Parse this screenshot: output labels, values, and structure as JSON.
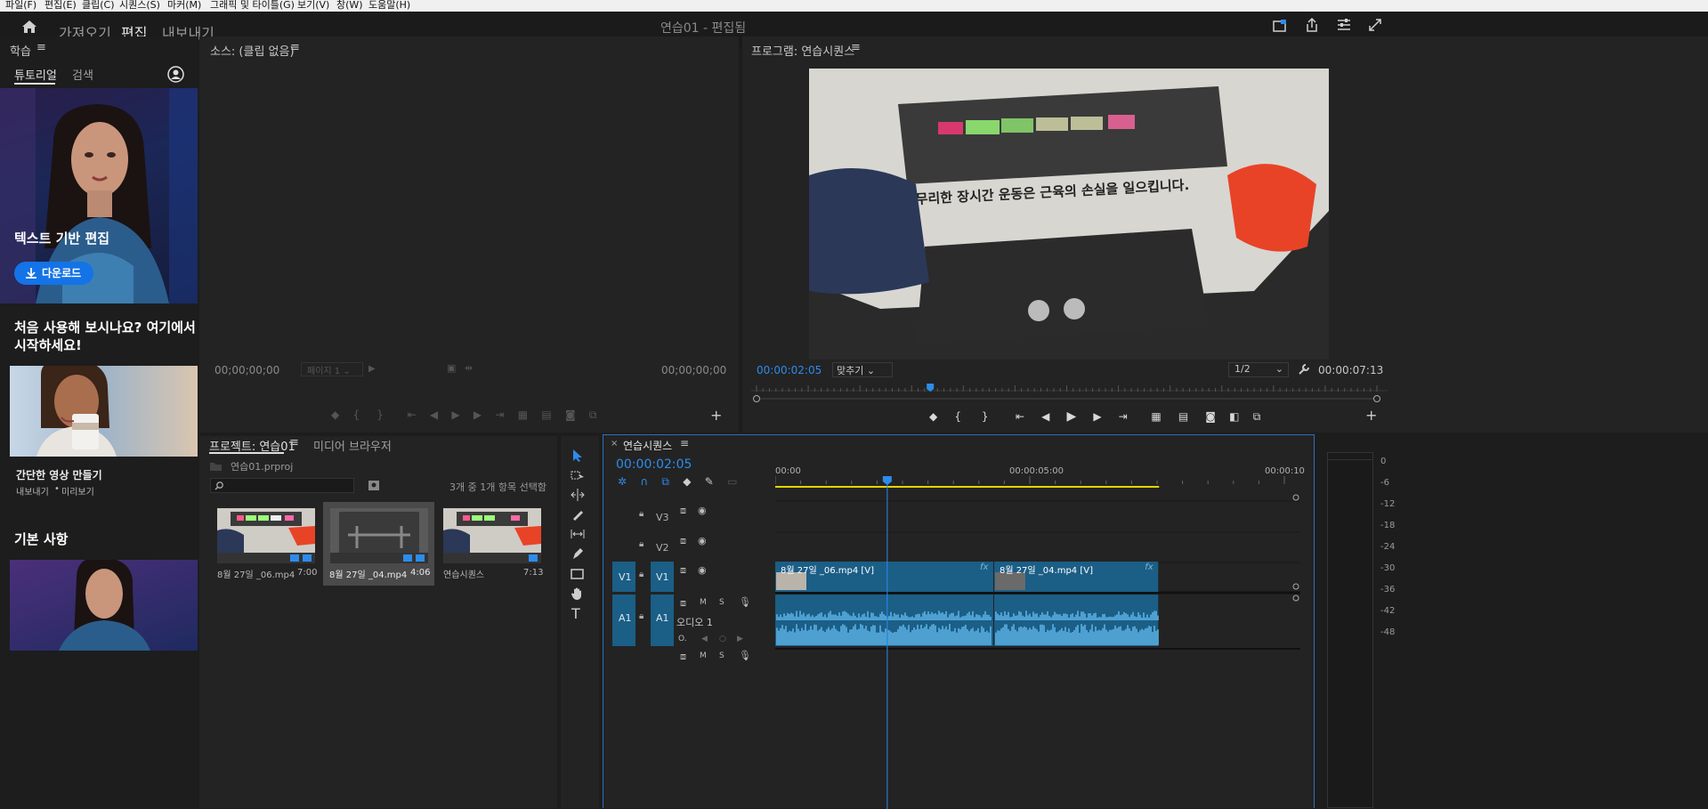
{
  "menubar": {
    "items": [
      "파일(F)",
      "편집(E)",
      "클립(C)",
      "시퀀스(S)",
      "마커(M)",
      "그래픽 및 타이틀(G)",
      "보기(V)",
      "창(W)",
      "도움말(H)"
    ]
  },
  "topbar": {
    "home_icon": "home-icon",
    "tabs": [
      {
        "label": "가져오기",
        "active": false
      },
      {
        "label": "편집",
        "active": true
      },
      {
        "label": "내보내기",
        "active": false
      }
    ],
    "title": "연습01 - 편집됨",
    "right_icons": [
      "quick-export-icon",
      "share-icon",
      "workspace-icon",
      "fullscreen-icon"
    ]
  },
  "learn_panel": {
    "title": "학습",
    "menu_icon": "≡",
    "tabs": [
      {
        "label": "튜토리얼",
        "active": true
      },
      {
        "label": "검색",
        "active": false
      }
    ],
    "hero": {
      "title": "텍스트 기반 편집",
      "button": "다운로드"
    },
    "section1_heading": "처음 사용해 보시나요? 여기에서 시작하세요!",
    "card1": {
      "title": "간단한 영상 만들기",
      "meta_a": "내보내기",
      "meta_sep": "•",
      "meta_b": "미리보기"
    },
    "section2_heading": "기본 사항"
  },
  "source_panel": {
    "title": "소스: (클립 없음)",
    "timecode_left": "00;00;00;00",
    "page_select": "페이지 1",
    "timecode_right": "00;00;00;00"
  },
  "program_panel": {
    "title": "프로그램: 연습시퀀스",
    "timecode_left": "00:00:02:05",
    "fit_select": "맞추기",
    "quality_select": "1/2",
    "timecode_right": "00:00:07:13",
    "video_caption": "무리한 장시간 운동은 근육의 손실을 일으킵니다.",
    "playhead_fraction": 0.28
  },
  "project_panel": {
    "tab_project": "프로젝트: 연습01",
    "tab_media": "미디어 브라우저",
    "project_file": "연습01.prproj",
    "selection_info": "3개 중 1개 항목 선택함",
    "search_placeholder": "",
    "items": [
      {
        "name": "8월 27일 _06.mp4",
        "duration": "7:00",
        "selected": false
      },
      {
        "name": "8월 27일 _04.mp4",
        "duration": "4:06",
        "selected": true
      },
      {
        "name": "연습시퀀스",
        "duration": "7:13",
        "selected": false
      }
    ]
  },
  "tools": {
    "items": [
      "selection-tool-icon",
      "track-select-icon",
      "ripple-edit-icon",
      "razor-icon",
      "slip-icon",
      "pen-icon",
      "rectangle-icon",
      "hand-icon",
      "type-icon"
    ]
  },
  "timeline": {
    "tab": "연습시퀀스",
    "timecode": "00:00:02:05",
    "ruler": [
      "00:00",
      "00:00:05:00",
      "00:00:10"
    ],
    "tracks": {
      "v3": "V3",
      "v2": "V2",
      "v1": "V1",
      "v1_source": "V1",
      "a1": "A1",
      "a1_source": "A1",
      "a1_name": "오디오 1",
      "mute": "M",
      "solo": "S"
    },
    "clips": {
      "video1": "8월 27일 _06.mp4 [V]",
      "video2": "8월 27일 _04.mp4 [V]",
      "fx": "fx"
    },
    "playhead_seconds": 2.2,
    "sequence_end_seconds": 7.54,
    "clip_split_seconds": 4.3
  },
  "audio_meter": {
    "labels": [
      "0",
      "-6",
      "-12",
      "-18",
      "-24",
      "-30",
      "-36",
      "-42",
      "-48"
    ]
  }
}
